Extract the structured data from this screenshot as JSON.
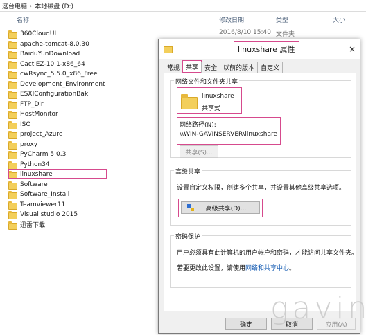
{
  "breadcrumb": {
    "root": "这台电脑",
    "drive": "本地磁盘 (D:)"
  },
  "columns": {
    "name": "名称",
    "modified": "修改日期",
    "type": "类型",
    "size": "大小"
  },
  "first_row_meta": {
    "modified": "2016/8/10 15:40",
    "type": "文件夹"
  },
  "folders": [
    "360CloudUI",
    "apache-tomcat-8.0.30",
    "BaiduYunDownload",
    "CactiEZ-10.1-x86_64",
    "cwRsync_5.5.0_x86_Free",
    "Development_Environment",
    "ESXIConfigurationBak",
    "FTP_Dir",
    "HostMonitor",
    "ISO",
    "project_Azure",
    "proxy",
    "PyCharm 5.0.3",
    "Python34",
    "linuxshare",
    "Software",
    "Software_Install",
    "Teamviewer11",
    "Visual studio 2015",
    "迅雷下载"
  ],
  "selected_folder": "linuxshare",
  "dialog": {
    "title": "linuxshare 属性",
    "close": "×",
    "tabs": [
      "常规",
      "共享",
      "安全",
      "以前的版本",
      "自定义"
    ],
    "active_tab": "共享",
    "net_group_label": "网络文件和文件夹共享",
    "share_name": "linuxshare",
    "share_status": "共享式",
    "net_path_label": "网络路径(N):",
    "net_path": "\\\\WIN-GAVINSERVER\\linuxshare",
    "share_button": "共享(S)...",
    "adv_group_label": "高级共享",
    "adv_desc": "设置自定义权限，创建多个共享，并设置其他高级共享选项。",
    "adv_button": "高级共享(D)...",
    "pwd_group_label": "密码保护",
    "pwd_desc": "用户必须具有此计算机的用户帐户和密码，才能访问共享文件夹。",
    "pwd_change_prefix": "若要更改此设置，请使用",
    "pwd_link": "网络和共享中心",
    "pwd_suffix": "。",
    "ok": "确定",
    "cancel": "取消",
    "apply": "应用(A)"
  },
  "watermark": "gavin"
}
